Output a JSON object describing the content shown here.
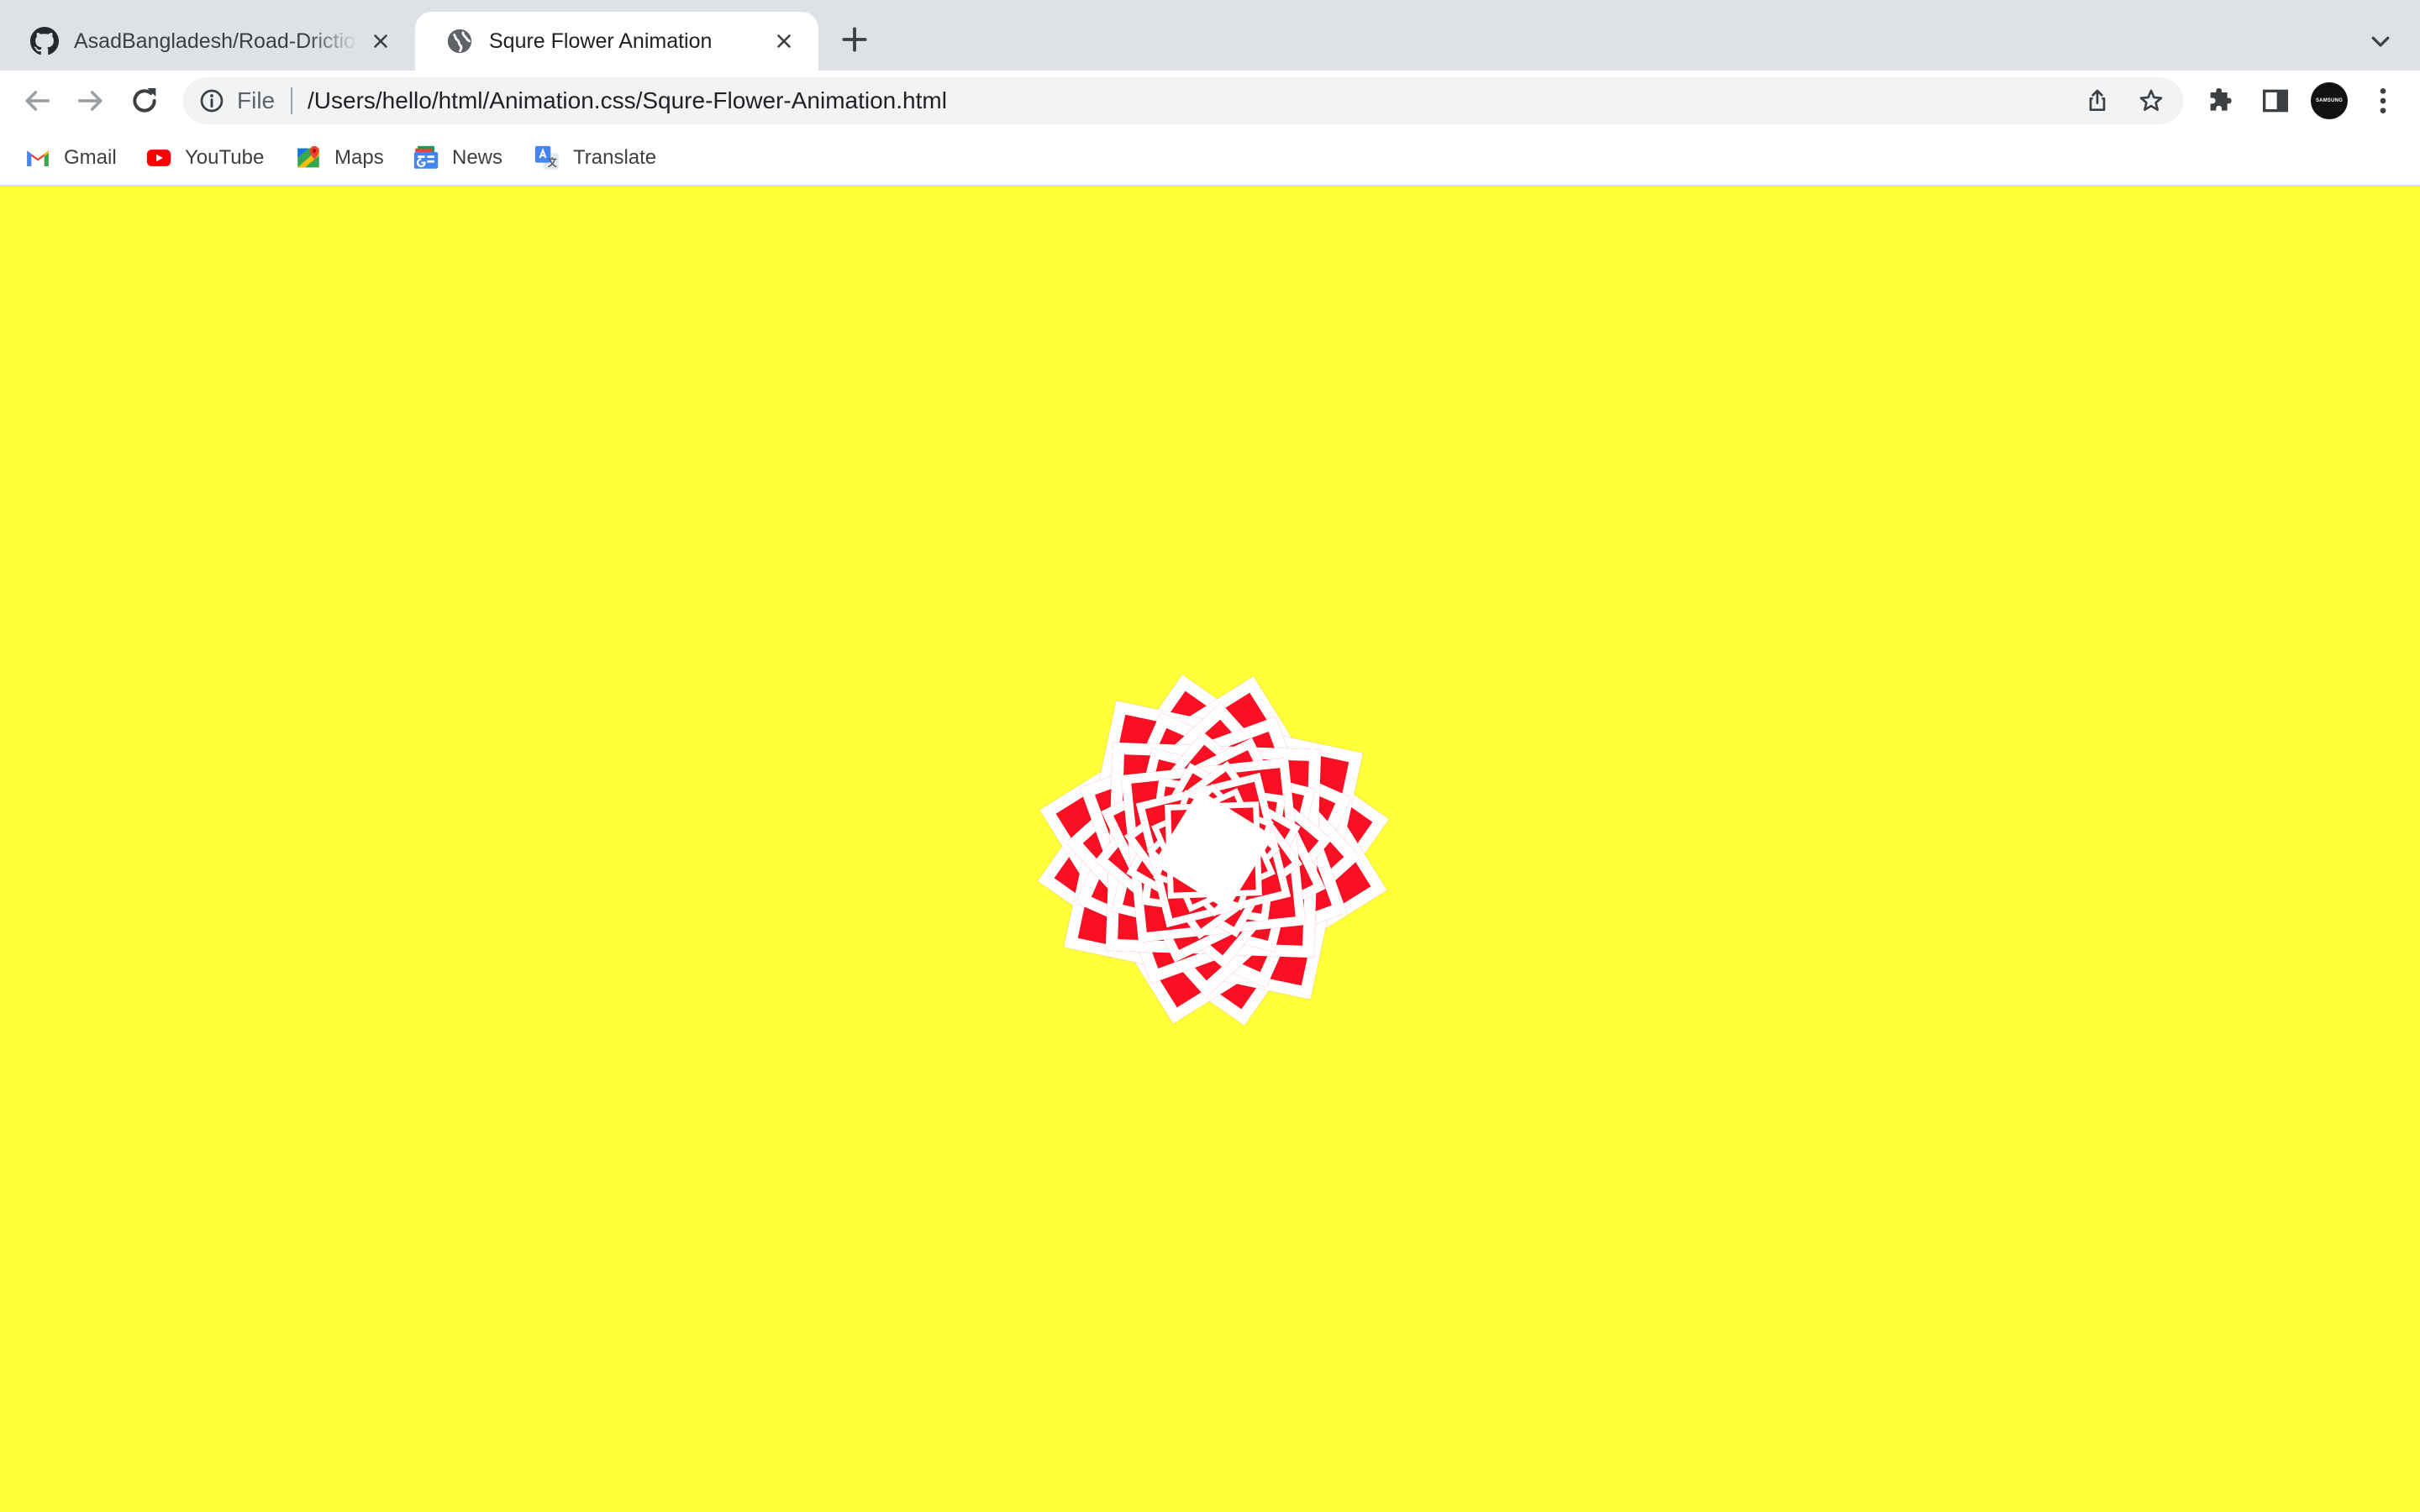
{
  "browser": {
    "tabs": [
      {
        "title": "AsadBangladesh/Road-Driction",
        "favicon": "github-icon",
        "active": false
      },
      {
        "title": "Squre Flower Animation",
        "favicon": "globe-icon",
        "active": true
      }
    ],
    "address_bar": {
      "scheme_label": "File",
      "url": "/Users/hello/html/Animation.css/Squre-Flower-Animation.html"
    },
    "profile_label": "SAMSUNG",
    "bookmarks": [
      {
        "label": "Gmail",
        "icon": "gmail-icon"
      },
      {
        "label": "YouTube",
        "icon": "youtube-icon"
      },
      {
        "label": "Maps",
        "icon": "maps-icon"
      },
      {
        "label": "News",
        "icon": "news-icon"
      },
      {
        "label": "Translate",
        "icon": "translate-icon"
      }
    ]
  },
  "page": {
    "background_color": "#ffff3a",
    "flower": {
      "petal_color": "#fb0f22",
      "outline_color": "#ffffff",
      "center_color": "#ffffff",
      "layers": 6,
      "squares_per_layer": 4
    }
  }
}
